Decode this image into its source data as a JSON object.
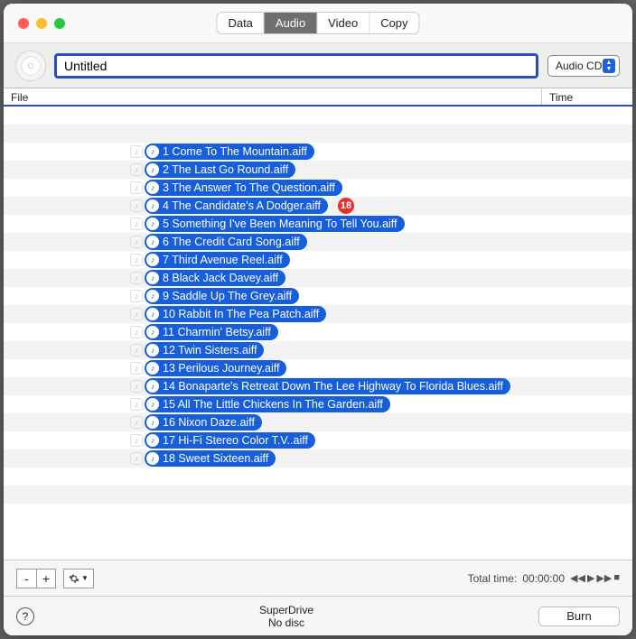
{
  "segments": {
    "data": "Data",
    "audio": "Audio",
    "video": "Video",
    "copy": "Copy"
  },
  "disc_title": "Untitled",
  "type_select": "Audio CD",
  "columns": {
    "file": "File",
    "time": "Time"
  },
  "tracks": [
    "1 Come To The Mountain.aiff",
    "2 The Last Go Round.aiff",
    "3 The Answer To The Question.aiff",
    "4 The Candidate's A Dodger.aiff",
    "5 Something I've Been Meaning To Tell You.aiff",
    "6 The Credit Card Song.aiff",
    "7 Third Avenue Reel.aiff",
    "8 Black Jack Davey.aiff",
    "9 Saddle Up The Grey.aiff",
    "10 Rabbit In The Pea Patch.aiff",
    "11 Charmin' Betsy.aiff",
    "12 Twin Sisters.aiff",
    "13 Perilous Journey.aiff",
    "14 Bonaparte's Retreat Down The Lee Highway To Florida Blues.aiff",
    "15 All The Little Chickens In The Garden.aiff",
    "16 Nixon Daze.aiff",
    "17 Hi-Fi Stereo Color T.V..aiff",
    "18 Sweet Sixteen.aiff"
  ],
  "badge": {
    "row": 4,
    "value": "18"
  },
  "total_label": "Total time:",
  "total_value": "00:00:00",
  "drive_name": "SuperDrive",
  "drive_status": "No disc",
  "burn_label": "Burn",
  "btn_minus": "-",
  "btn_plus": "+"
}
